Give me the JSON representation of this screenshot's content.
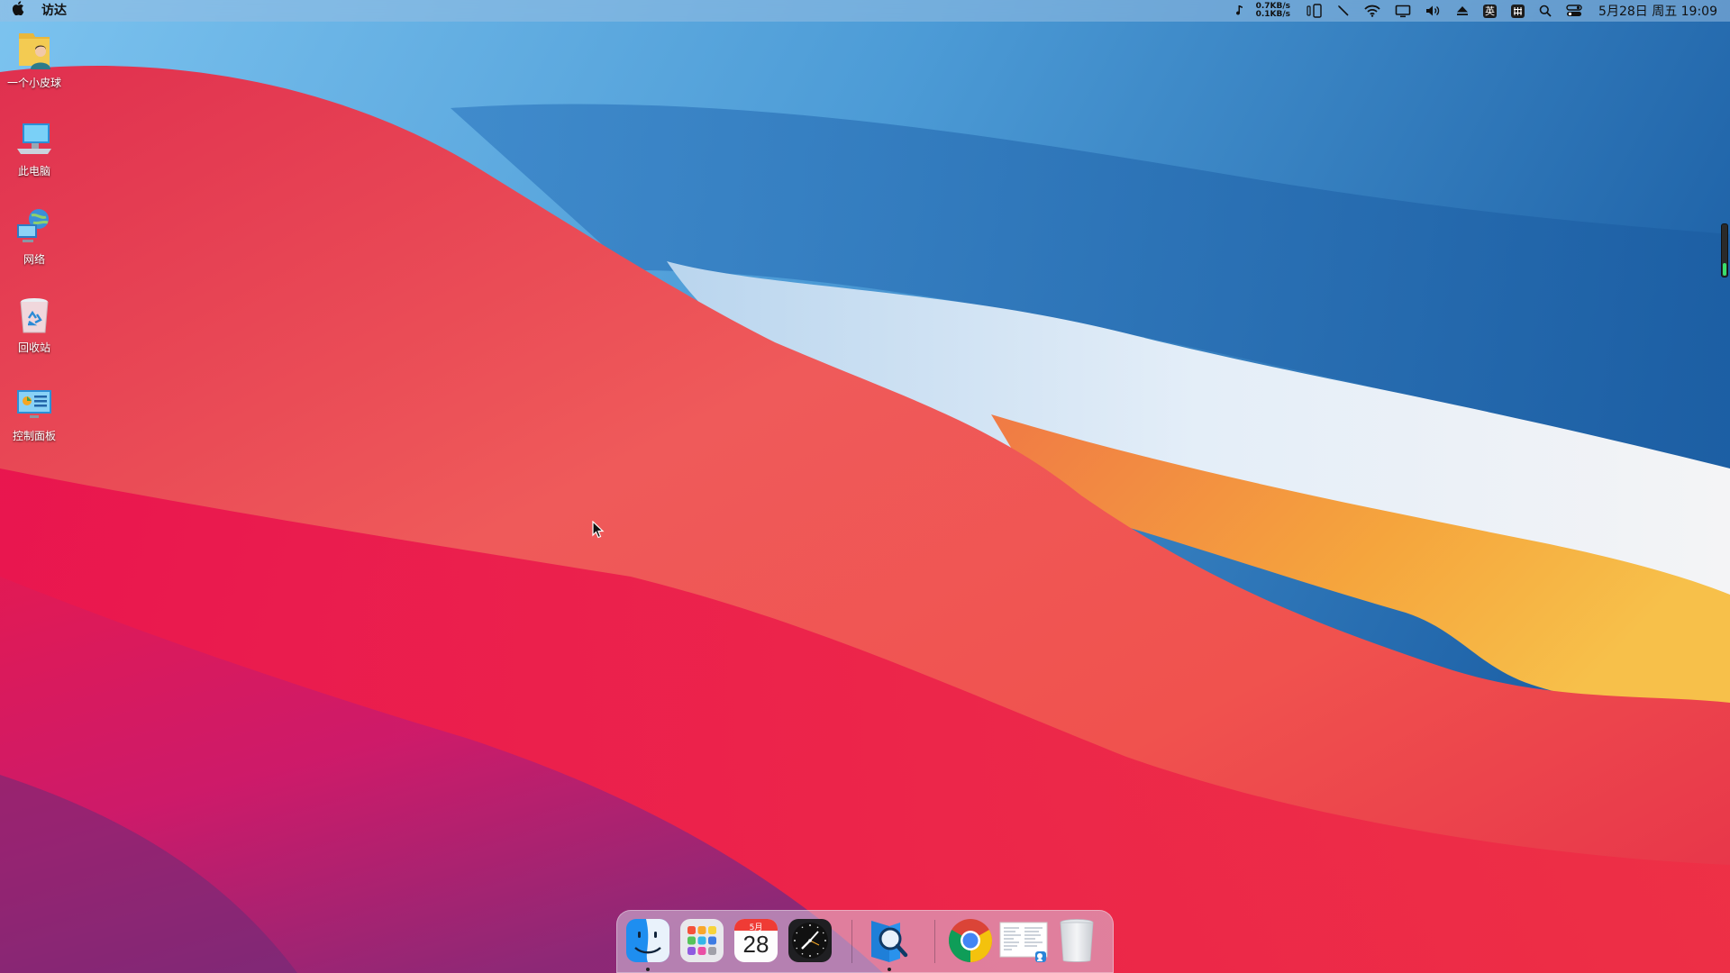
{
  "menubar": {
    "apple_icon": "apple-logo-icon",
    "app_name": "访达",
    "net_upload": "0.7KB/s",
    "net_download": "0.1KB/s",
    "input_method_label": "英",
    "datetime": "5月28日 周五 19:09",
    "status_icons": [
      "music-note-icon",
      "network-speed",
      "phone-link-icon",
      "pen-icon",
      "wifi-icon",
      "display-icon",
      "volume-icon",
      "eject-icon",
      "input-method-icon",
      "keyboard-grid-icon",
      "search-icon",
      "control-center-icon"
    ]
  },
  "desktop": {
    "icons": [
      {
        "label": "一个小皮球",
        "icon": "user-folder-icon"
      },
      {
        "label": "此电脑",
        "icon": "computer-icon"
      },
      {
        "label": "网络",
        "icon": "network-globe-icon"
      },
      {
        "label": "回收站",
        "icon": "recycle-bin-icon"
      },
      {
        "label": "控制面板",
        "icon": "control-panel-icon"
      }
    ]
  },
  "dock": {
    "items": [
      {
        "name": "Finder",
        "icon": "finder-icon",
        "running": true
      },
      {
        "name": "Launchpad",
        "icon": "launchpad-icon",
        "running": false
      },
      {
        "name": "Calendar",
        "icon": "calendar-icon",
        "running": false,
        "month": "5月",
        "day": "28"
      },
      {
        "name": "Clock",
        "icon": "clock-icon",
        "running": false
      },
      {
        "name": "Search",
        "icon": "search-app-icon",
        "running": true
      },
      {
        "name": "Chrome",
        "icon": "chrome-icon",
        "running": false
      },
      {
        "name": "Document",
        "icon": "document-preview-icon",
        "running": false
      },
      {
        "name": "Trash",
        "icon": "trash-icon",
        "running": false
      }
    ]
  },
  "colors": {
    "wall_red": "#e8264a",
    "wall_blue": "#2f7fc4",
    "wall_orange": "#f3a63a",
    "wall_white": "#d9e6f2",
    "wall_magenta": "#a0257a"
  }
}
